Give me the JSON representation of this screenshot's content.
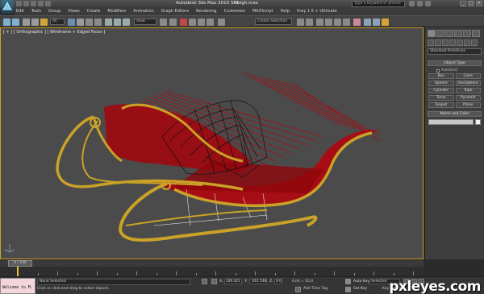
{
  "window": {
    "title": "Autodesk 3ds Max 2010 SP1",
    "file": "sleigh.max",
    "search_placeholder": "Type a keyword or phrase"
  },
  "menu": [
    "Edit",
    "Tools",
    "Group",
    "Views",
    "Create",
    "Modifiers",
    "Animation",
    "Graph Editors",
    "Rendering",
    "Customize",
    "MAXScript",
    "Help",
    "Vray 1.5 + Ultimate"
  ],
  "toolbar": {
    "filter_dropdown": "All",
    "view_dropdown": "View",
    "named_selection_placeholder": "Create Selection"
  },
  "viewport": {
    "label": "[ + ] [ Orthographic ] [ Wireframe + Edged Faces ]",
    "colors": {
      "sleigh_body": "#b0070e",
      "runner": "#c9a227",
      "wire": "#111111",
      "border": "#c9a227"
    }
  },
  "command_panel": {
    "dropdown": "Standard Primitives",
    "object_type_title": "Object Type",
    "autogrid_label": "AutoGrid",
    "object_buttons": [
      "Box",
      "Cone",
      "Sphere",
      "GeoSphere",
      "Cylinder",
      "Tube",
      "Torus",
      "Pyramid",
      "Teapot",
      "Plane"
    ],
    "name_color_title": "Name and Color"
  },
  "timeline": {
    "slider_label": "0 / 100"
  },
  "status": {
    "maxscript_text": "Welcome to M.",
    "selection": "None Selected",
    "prompt": "Click or click-and-drag to select objects",
    "x_label": "X:",
    "x_value": "326.421",
    "y_label": "Y:",
    "y_value": "-161.548",
    "z_label": "Z:",
    "z_value": "0.0",
    "grid": "Grid = 10.0",
    "time_tag": "Add Time Tag",
    "auto_key": "Auto Key",
    "set_key": "Set Key",
    "selected_dropdown": "Selected",
    "key_filters": "Key Filters..."
  },
  "watermark": "pxleyes.com"
}
